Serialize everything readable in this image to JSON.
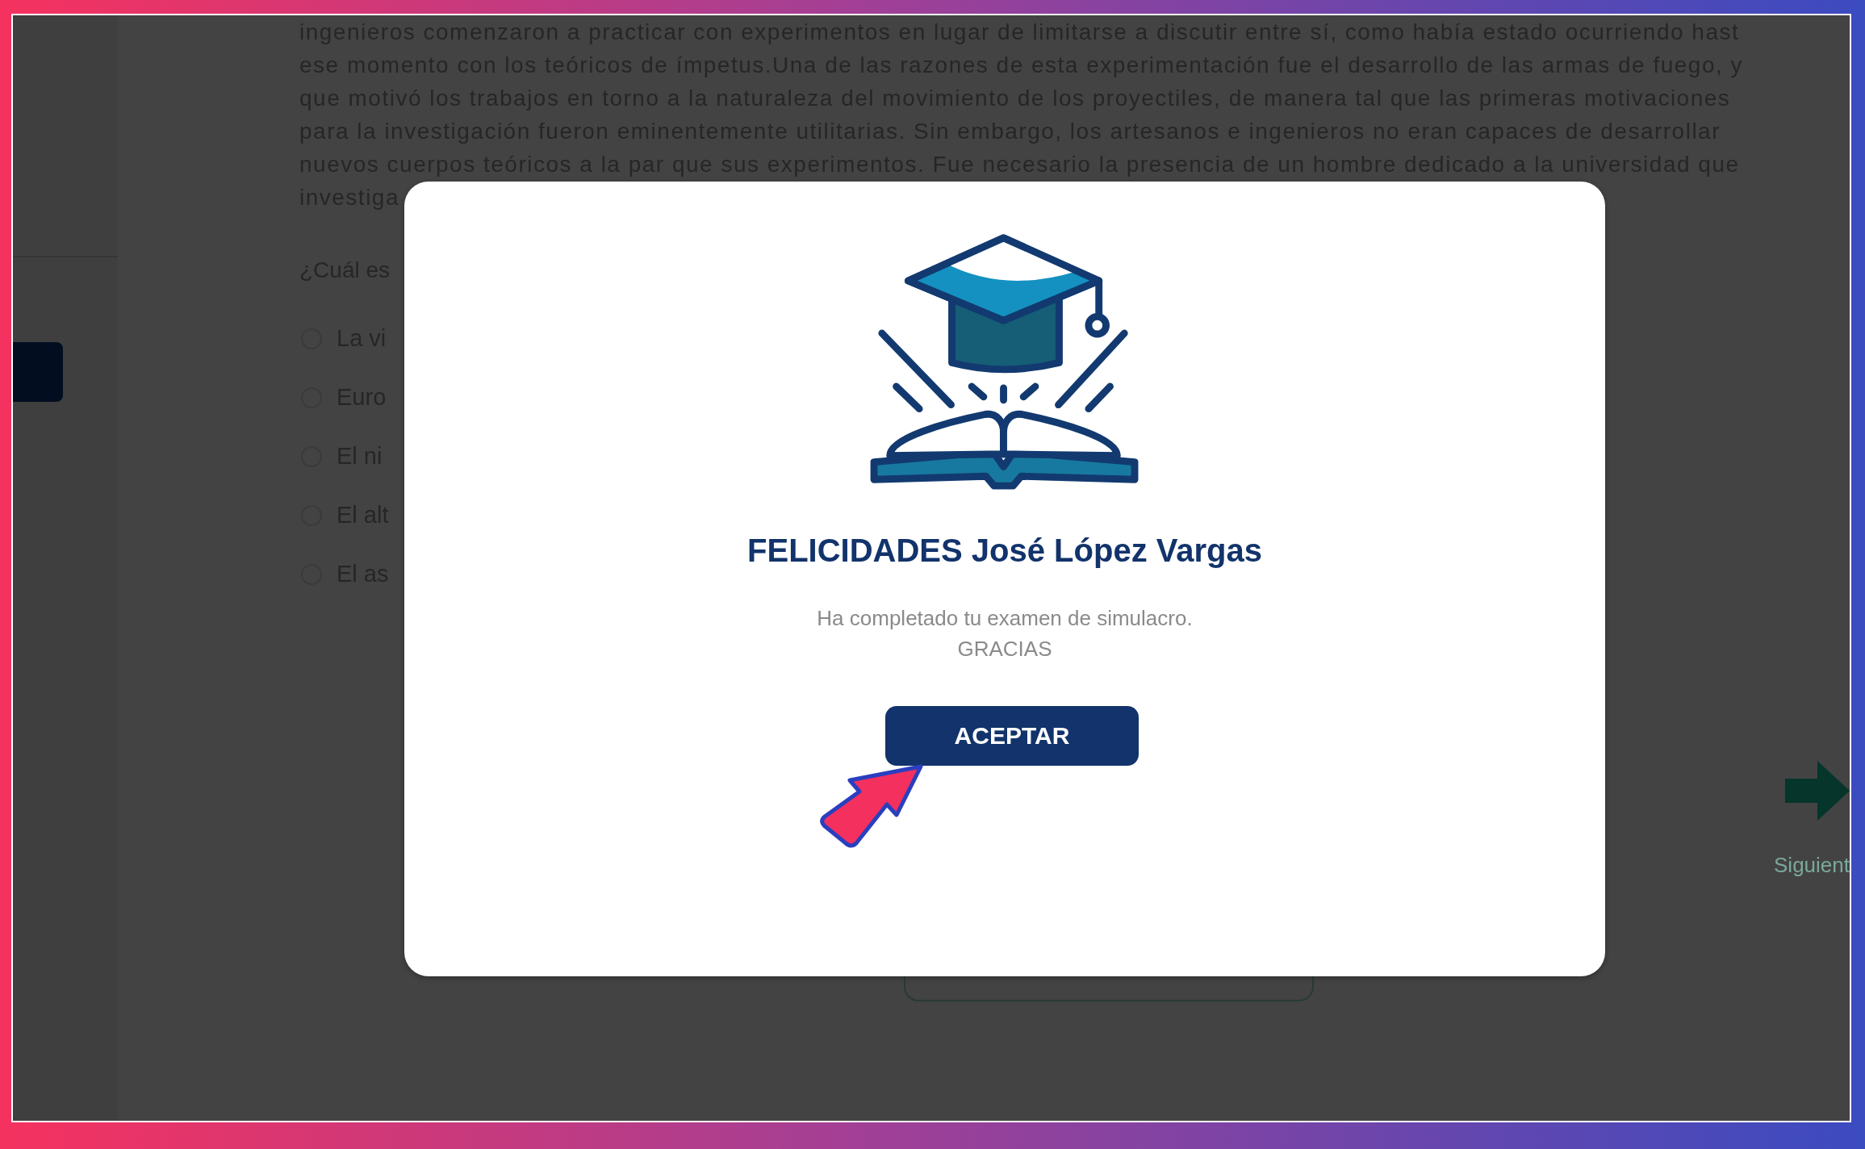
{
  "passage_lines": [
    "ingenieros comenzaron a practicar con experimentos en lugar de limitarse a discutir entre sí, como había estado ocurriendo hast",
    "ese momento con los teóricos de ímpetus.Una de las razones de esta experimentación fue el desarrollo de las armas de fuego, y",
    "que motivó los trabajos en torno a la naturaleza del movimiento de los proyectiles, de manera tal que las primeras motivaciones",
    "para la investigación fueron eminentemente utilitarias. Sin embargo, los artesanos e ingenieros no eran capaces de desarrollar",
    "nuevos cuerpos teóricos a la par que sus experimentos. Fue necesario la presencia de un hombre dedicado a la universidad que",
    "investiga"
  ],
  "question": "¿Cuál es",
  "options": [
    {
      "label": "La vi",
      "selected": false
    },
    {
      "label": "Euro",
      "selected": false
    },
    {
      "label": "El ni",
      "selected": false
    },
    {
      "label": "El alt",
      "selected": false
    },
    {
      "label": "El as",
      "selected": false
    }
  ],
  "next": {
    "label": "Siguient"
  },
  "modal": {
    "title": "FELICIDADES José López Vargas",
    "message_lines": [
      "Ha completado tu examen de simulacro.",
      "GRACIAS"
    ],
    "button": "ACEPTAR"
  }
}
